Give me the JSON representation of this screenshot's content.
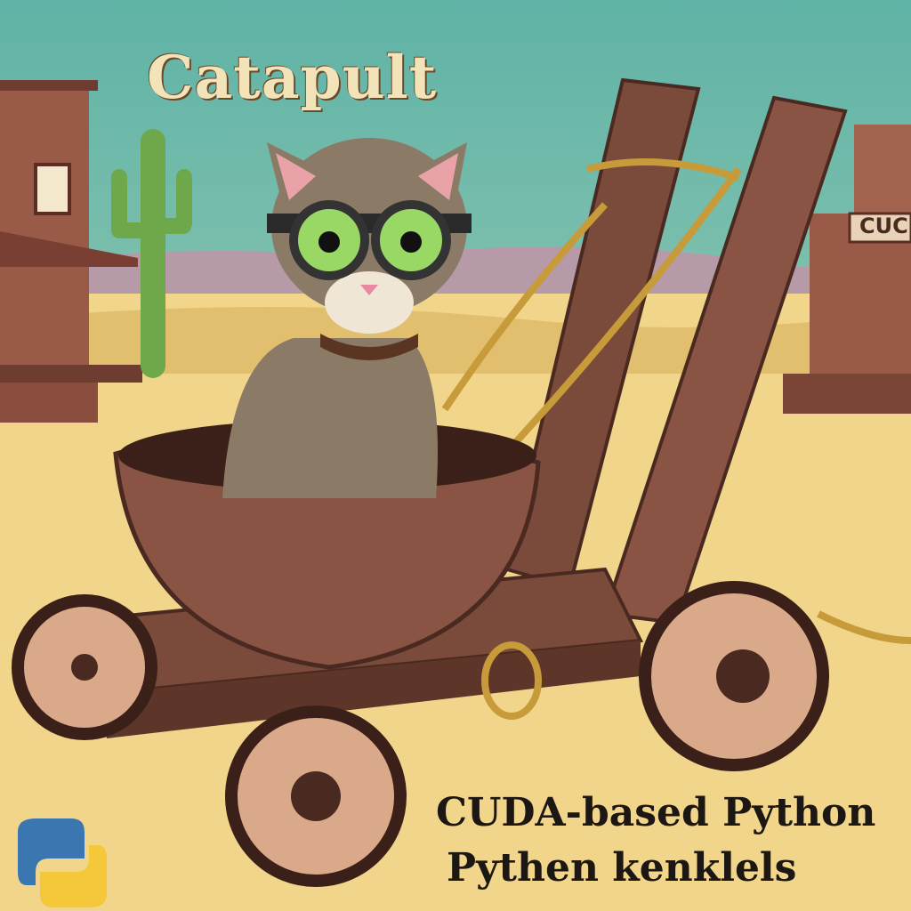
{
  "title": "Catapult",
  "subtitle_line1": "CUDA-based Python",
  "subtitle_line2": "Pythen kenklels",
  "building_sign": "CUC",
  "colors": {
    "sky": "#5fb3a6",
    "sand": "#f0d58a",
    "wood": "#7a4a3a",
    "rope": "#c79a3a"
  }
}
